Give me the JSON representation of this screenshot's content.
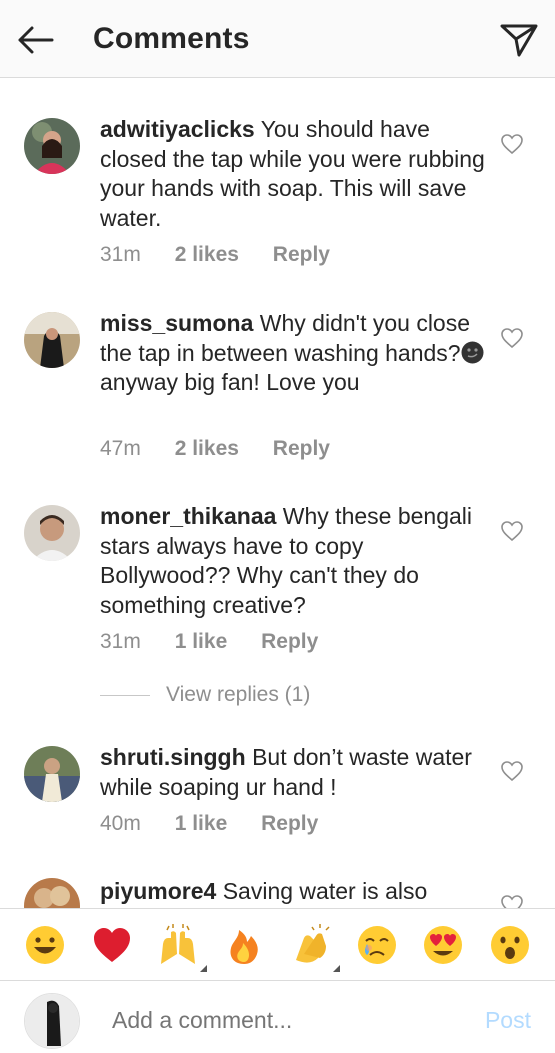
{
  "header": {
    "title": "Comments",
    "back_icon": "arrow-left-icon",
    "share_icon": "paper-plane-icon"
  },
  "comments": [
    {
      "username": "adwitiyaclicks",
      "text": "You should have closed the tap while you were rubbing your hands with soap. This will save water.",
      "time": "31m",
      "likes": "2 likes",
      "reply": "Reply"
    },
    {
      "username": "miss_sumona",
      "text": "Why didn't you close the tap in between washing hands?",
      "text_after_emoji": "anyway big fan! Love you",
      "time": "47m",
      "likes": "2 likes",
      "reply": "Reply"
    },
    {
      "username": "moner_thikanaa",
      "text": "Why these bengali stars always have to copy Bollywood?? Why can't they do something creative?",
      "time": "31m",
      "likes": "1 like",
      "reply": "Reply"
    },
    {
      "username": "shruti.singgh",
      "text": "But don’t waste water while soaping ur hand !",
      "time": "40m",
      "likes": "1 like",
      "reply": "Reply"
    },
    {
      "username": "piyumore4",
      "text": "Saving water is also"
    }
  ],
  "view_replies": "View replies (1)",
  "emoji_bar": [
    "grinning-face",
    "red-heart",
    "raising-hands",
    "fire",
    "clapping-hands",
    "crying-face",
    "heart-eyes",
    "surprised-face"
  ],
  "composer": {
    "placeholder": "Add a comment...",
    "post_label": "Post"
  },
  "colors": {
    "text": "#262626",
    "muted": "#8e8e8e",
    "post_disabled": "#b3dbff",
    "divider": "#dbdbdb"
  }
}
